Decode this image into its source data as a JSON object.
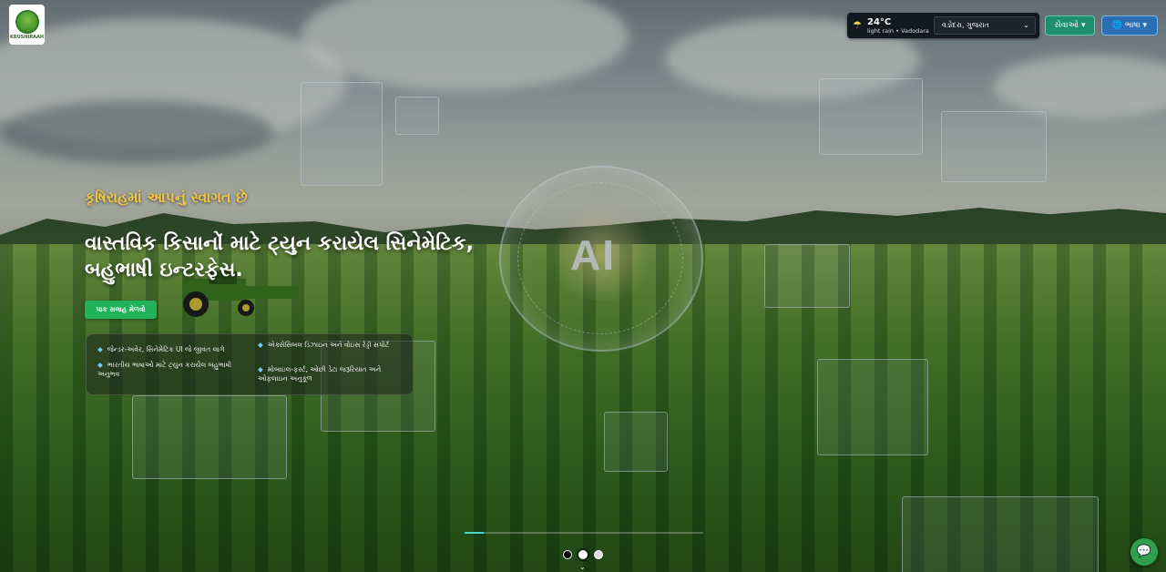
{
  "header": {
    "logo_text": "KRUSHIRAAH",
    "weather": {
      "temperature": "24°C",
      "condition": "light rain",
      "location": "Vadodara",
      "separator": "•"
    },
    "city_select": "વડોદરા, ગુજરાત",
    "services_label": "સેવાઓ",
    "language_label": "ભાષા"
  },
  "hero": {
    "welcome": "કૃષિરાહમાં આપનું સ્વાગત છે",
    "headline": "વાસ્તવિક કિસાનોં માટે ટ્યુન કરાયેલ સિનેમેટિક, બહુભાષી ઇન્ટરફેસ.",
    "cta_label": "પાક સલાહ મેળવો",
    "background_ai_text": "AI",
    "features": [
      "જેન્ડર-અવેર, સિનેમેટિક UI જે જીવંત લાગે",
      "ભારતીય ભાષાઓ માટે ટ્યુન કરાયેલ બહુભાષી અનુભવ",
      "એક્સેસિબલ ડિઝાઇન અને વોઇસ રેડ્ડી સપોર્ટ",
      "મોબાઇલ-ફર્સ્ટ, ઓછી ડેટા જરૂરિયાત અને ઓફલાઇન અનુકૂળ"
    ]
  },
  "carousel": {
    "slide_count": 3,
    "active_index": 1,
    "progress_fraction": 0.08
  },
  "colors": {
    "welcome_gold": "#f3c646",
    "cta_green": "#21b35a",
    "services_teal": "#1d8f6e",
    "language_blue": "#2a6fb3",
    "chat_green": "#2f9e4f"
  },
  "icons": {
    "weather": "cloud-rain-icon",
    "chevron": "chevron-down-icon",
    "language": "globe-icon",
    "chat": "chat-bubble-icon",
    "bullet": "diamond-bullet-icon"
  }
}
